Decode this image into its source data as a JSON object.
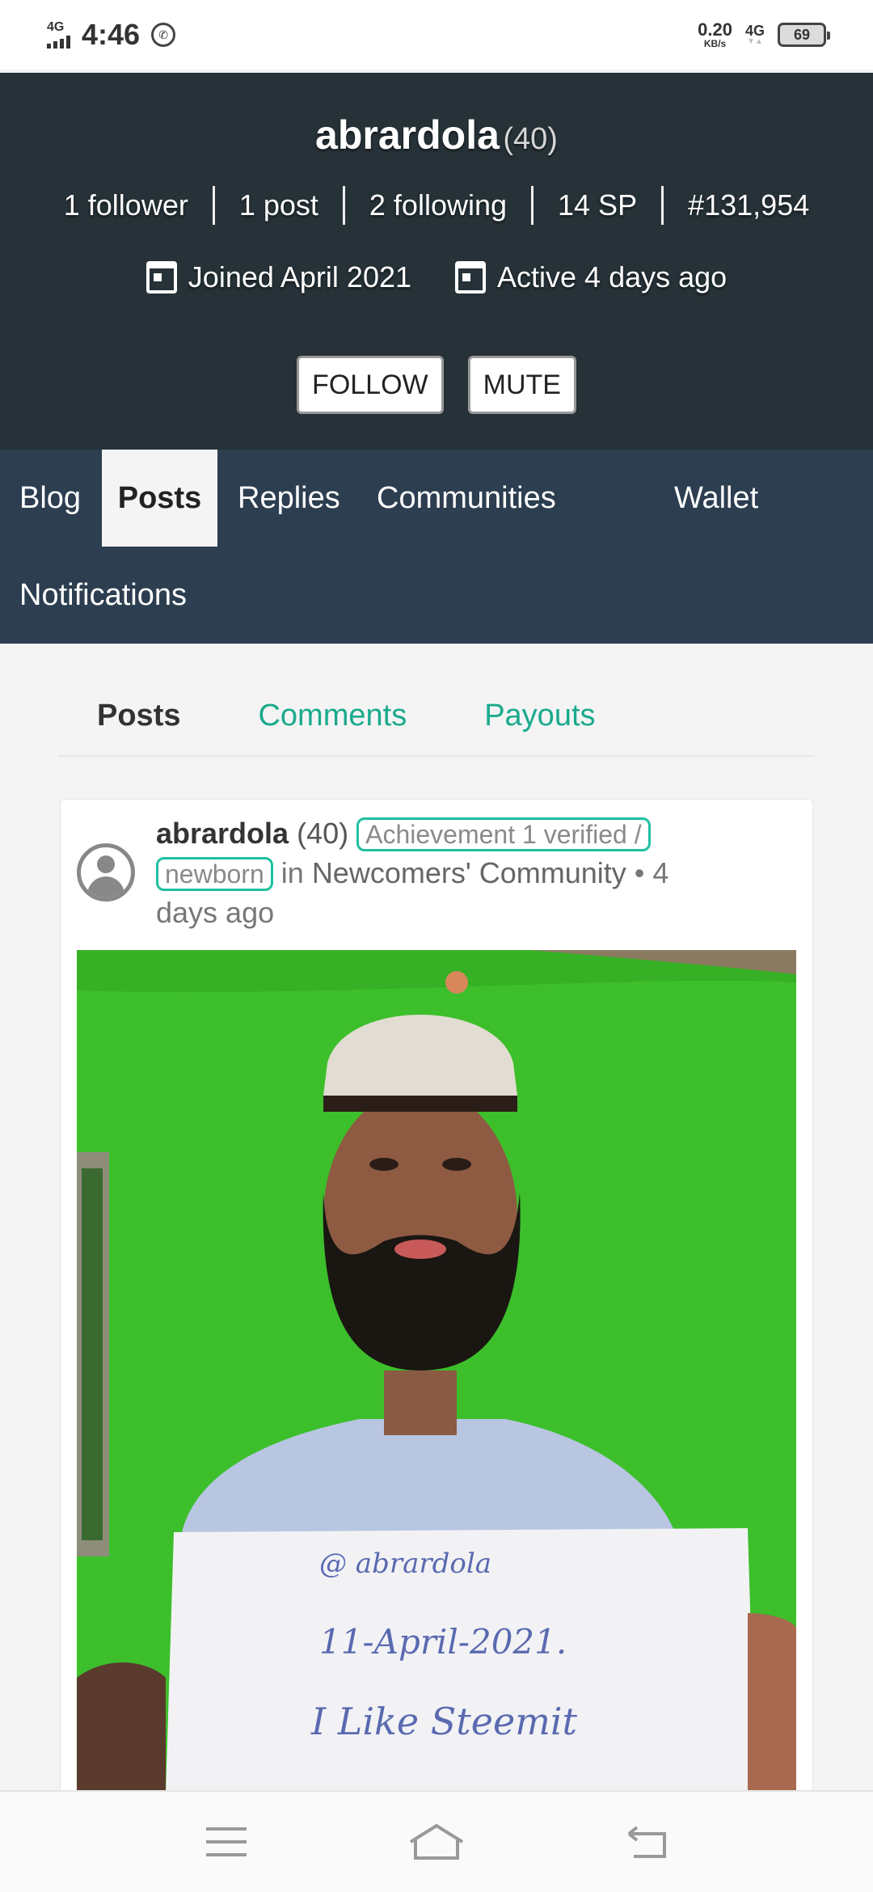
{
  "status_bar": {
    "network": "4G",
    "time": "4:46",
    "speed_value": "0.20",
    "speed_unit": "KB/s",
    "network_right": "4G",
    "battery": "69"
  },
  "profile": {
    "name": "abrardola",
    "reputation": "(40)",
    "stats": [
      "1 follower",
      "1 post",
      "2 following",
      "14 SP",
      "#131,954"
    ],
    "joined": "Joined April 2021",
    "active": "Active 4 days ago",
    "follow_label": "FOLLOW",
    "mute_label": "MUTE"
  },
  "tabs": {
    "blog": "Blog",
    "posts": "Posts",
    "replies": "Replies",
    "communities": "Communities",
    "wallet": "Wallet",
    "notifications": "Notifications",
    "active": "Posts"
  },
  "subtabs": {
    "posts": "Posts",
    "comments": "Comments",
    "payouts": "Payouts"
  },
  "post": {
    "author": "abrardola",
    "reputation": "(40)",
    "badge_line1": "Achievement 1 verified /",
    "badge_line2": "newborn",
    "in_text": "in",
    "community": "Newcomers' Community",
    "separator": "•",
    "time_part1": "4",
    "time_part2": "days ago",
    "sign_line1": "@ abrardola",
    "sign_line2": "11-April-2021.",
    "sign_line3": "I Like Steemit"
  },
  "colors": {
    "header_bg": "#263238",
    "tabs_bg": "#2c3e50",
    "accent": "#1aaa8c"
  }
}
